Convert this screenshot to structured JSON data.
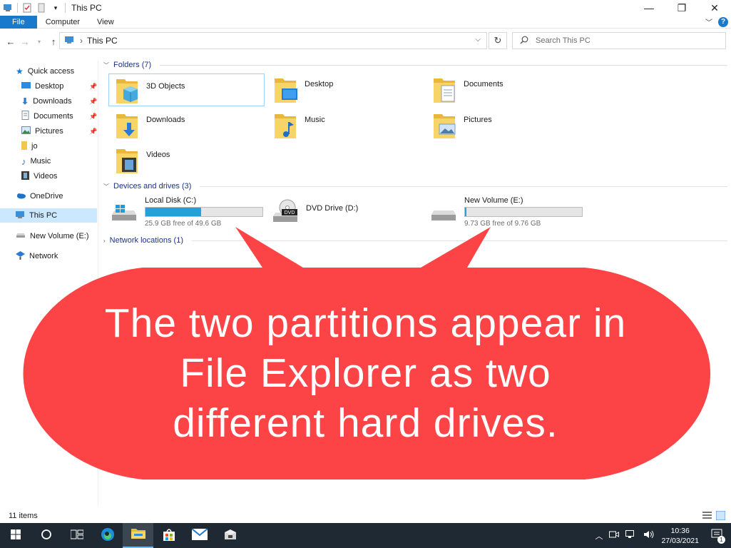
{
  "window": {
    "title": "This PC",
    "controls": {
      "minimize": "—",
      "maximize": "❐",
      "close": "✕"
    }
  },
  "ribbon": {
    "tabs": [
      "File",
      "Computer",
      "View"
    ],
    "help_label": "?"
  },
  "address": {
    "location": "This PC",
    "separator": "›"
  },
  "search": {
    "placeholder": "Search This PC"
  },
  "sidebar": {
    "items": [
      {
        "label": "Quick access",
        "icon": "star-icon"
      },
      {
        "label": "Desktop",
        "icon": "desktop-icon",
        "pinned": true
      },
      {
        "label": "Downloads",
        "icon": "download-arrow-icon",
        "pinned": true
      },
      {
        "label": "Documents",
        "icon": "document-icon",
        "pinned": true
      },
      {
        "label": "Pictures",
        "icon": "picture-icon",
        "pinned": true
      },
      {
        "label": "jo",
        "icon": "folder-icon"
      },
      {
        "label": "Music",
        "icon": "music-note-icon"
      },
      {
        "label": "Videos",
        "icon": "film-icon"
      },
      {
        "label": "OneDrive",
        "icon": "cloud-icon"
      },
      {
        "label": "This PC",
        "icon": "computer-icon",
        "selected": true
      },
      {
        "label": "New Volume (E:)",
        "icon": "drive-icon"
      },
      {
        "label": "Network",
        "icon": "network-icon"
      }
    ]
  },
  "groups": {
    "folders": {
      "label": "Folders (7)"
    },
    "devices": {
      "label": "Devices and drives (3)"
    },
    "network": {
      "label": "Network locations (1)"
    }
  },
  "folders": [
    {
      "label": "3D Objects",
      "icon": "3d-objects-folder-icon"
    },
    {
      "label": "Desktop",
      "icon": "desktop-folder-icon"
    },
    {
      "label": "Documents",
      "icon": "documents-folder-icon"
    },
    {
      "label": "Downloads",
      "icon": "downloads-folder-icon"
    },
    {
      "label": "Music",
      "icon": "music-folder-icon"
    },
    {
      "label": "Pictures",
      "icon": "pictures-folder-icon"
    },
    {
      "label": "Videos",
      "icon": "videos-folder-icon"
    }
  ],
  "drives": [
    {
      "label": "Local Disk (C:)",
      "free_text": "25.9 GB free of 49.6 GB",
      "used_fraction": 0.478,
      "icon": "windows-drive-icon"
    },
    {
      "label": "DVD Drive (D:)",
      "icon": "dvd-drive-icon",
      "badge": "DVD"
    },
    {
      "label": "New Volume (E:)",
      "free_text": "9.73 GB free of 9.76 GB",
      "used_fraction": 0.003,
      "icon": "drive-icon"
    }
  ],
  "status": {
    "item_count": "11 items"
  },
  "taskbar": {
    "time": "10:36",
    "date": "27/03/2021",
    "notification_count": "1"
  },
  "callout": {
    "lines": [
      "The two partitions appear in",
      "File Explorer as two",
      "different hard drives."
    ],
    "color": "#fc4447"
  },
  "colors": {
    "accent": "#1979ca",
    "drive_bar": "#26a0da",
    "taskbar": "#1f2933"
  }
}
